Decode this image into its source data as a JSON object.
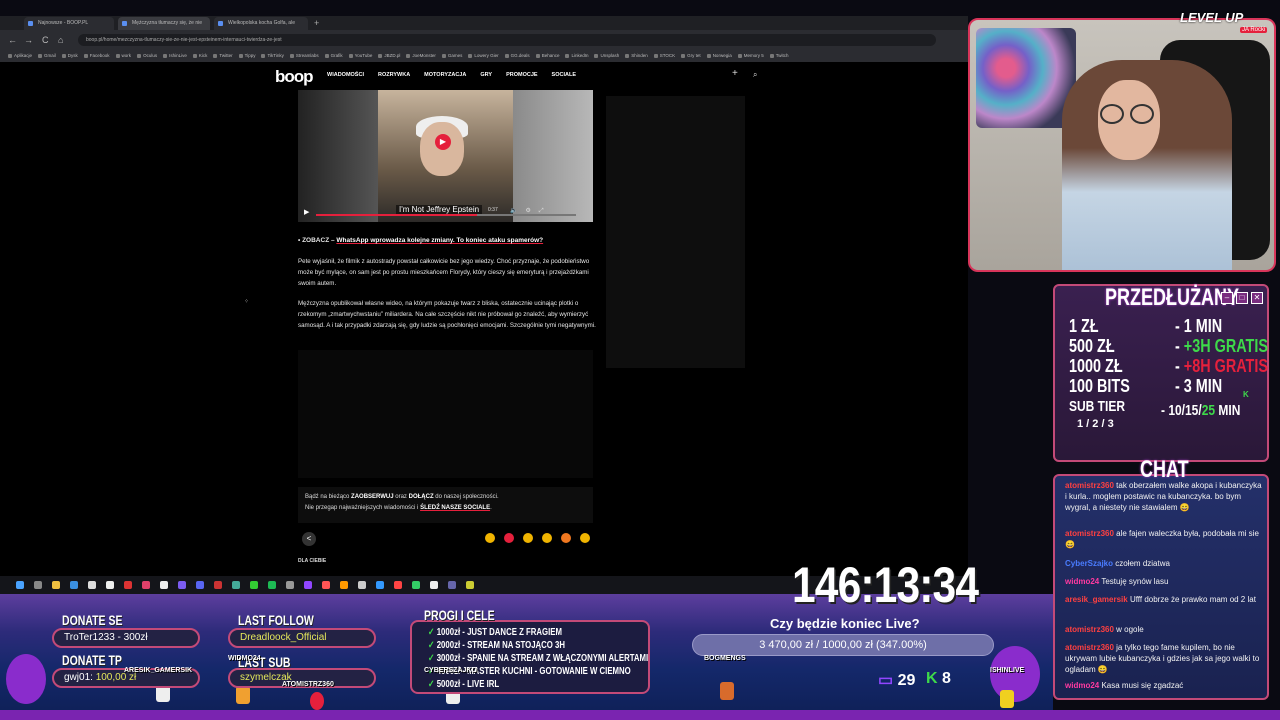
{
  "browser": {
    "tabs": [
      "Najnowsze - BOOP.PL",
      "Mężczyzna tłumaczy się, że nie",
      "Wielkopolska kocha Golfa, ale"
    ],
    "new_tab": "+",
    "url": "boop.pl/home/mezczyzna-tlumaczy-sie-ze-nie-jest-epsteinem-internauci-twierdza-ze-jest",
    "nav": {
      "back": "←",
      "forward": "→",
      "reload": "C",
      "home": "⌂"
    },
    "bookmarks": [
      "Aplikacje",
      "Gmail",
      "Dysk",
      "Facebook",
      "work",
      "Oculus",
      "IshinLive",
      "Kick",
      "Twitter",
      "Tippy",
      "TikTinky",
      "Streamlabs",
      "Grafik",
      "YouTube",
      "JBZD.pl",
      "JoeMonster",
      "Games",
      "Lowery Gier",
      "GG.deals",
      "Behance",
      "LinkedIn",
      "Unsplash",
      "Shinden",
      "STOCK",
      "Gry tet",
      "Norwegia",
      "Memory 5",
      "Twitch"
    ]
  },
  "site": {
    "logo": "boop",
    "nav": [
      "WIADOMOŚCI",
      "ROZRYWKA",
      "MOTORYZACJA",
      "GRY",
      "PROMOCJE",
      "SOCIALE"
    ],
    "plus": "+",
    "search": "⌕",
    "video": {
      "caption": "I'm Not Jeffrey Epstein",
      "time": "0:37",
      "progress": 0.62
    },
    "zobacz_prefix": "• ZOBACZ – ",
    "zobacz_link": "WhatsApp wprowadza kolejne zmiany. To koniec ataku spamerów?",
    "p1": "Pete wyjaśnił, że filmik z autostrady powstał całkowicie bez jego wiedzy. Choć przyznaje, że podobieństwo może być mylące, on sam jest po prostu mieszkańcem Florydy, który cieszy się emeryturą i przejażdżkami swoim autem.",
    "p2": "Mężczyzna opublikował własne wideo, na którym pokazuje twarz z bliska, ostatecznie ucinając plotki o rzekomym „zmartwychwstaniu” miliardera. Na całe szczęście nikt nie próbował go znaleźć, aby wymierzyć samosąd. A i tak przypadki zdarzają się, gdy ludzie są pochłonięci emocjami. Szczególnie tymi negatywnymi.",
    "follow_1a": "Bądź na bieżąco ",
    "follow_1b": "ZAOBSERWUJ",
    "follow_1c": " oraz ",
    "follow_1d": "DOŁĄCZ",
    "follow_1e": " do naszej społeczności.",
    "follow_2a": "Nie przegap najważniejszych wiadomości i ",
    "follow_2b": "ŚLEDŹ NASZE SOCIALE",
    "follow_2c": ".",
    "dla_ciebie": "DLA CIEBIE"
  },
  "overlay": {
    "levelup": "LEVEL UP",
    "levelup_sub": "JA Rocki",
    "prices_title": "PRZEDŁUŻANY",
    "prices": [
      {
        "amount": "1 ZŁ",
        "time": "- 1 MIN"
      },
      {
        "amount": "500 ZŁ",
        "time": "- ",
        "extra": "+3H GRATIS"
      },
      {
        "amount": "1000 ZŁ",
        "time": "- ",
        "extra": "+8H GRATIS"
      },
      {
        "amount": "100 BITS",
        "time": "- 3 MIN"
      },
      {
        "amount": "SUB TIER",
        "time": "- 10/15/",
        "extra": "25",
        "tail": " MIN"
      }
    ],
    "subtier_sub": "1 / 2 / 3",
    "k_mark": "K",
    "chat_title": "CHAT",
    "chat": [
      {
        "user": "atomistrz360",
        "text": " tak oberzałem walke akopa i kubanczyka i kurla.. moglem postawic na kubanczyka. bo bym wygral, a niestety nie stawialem 😄"
      },
      {
        "user": "atomistrz360",
        "text": " ale fajen waleczka była, podobała mi sie 😄"
      },
      {
        "user": "CyberSzajko",
        "text": " czołem dziatwa"
      },
      {
        "user": "widmo24",
        "text": " Testuję synów lasu"
      },
      {
        "user": "aresik_gamersik",
        "text": " Ufff dobrze że prawko mam od 2 lat"
      },
      {
        "user": "atomistrz360",
        "text": " w ogole"
      },
      {
        "user": "atomistrz360",
        "text": " ja tylko tego fame kupilem, bo nie ukrywam lubie kubanczyka i gdzies jak sa jego walki to ogladam 😄"
      },
      {
        "user": "widmo24",
        "text": " Kasa musi się zgadzać"
      }
    ],
    "donate_se_title": "DONATE SE",
    "donate_se": "TroTer1233 - 300zł",
    "donate_tp_title": "DONATE TP",
    "donate_tp_user": "gwj01: ",
    "donate_tp_amount": "100,00 zł",
    "last_follow_title": "LAST FOLLOW",
    "last_follow": "Dreadloock_Official",
    "last_sub_title": "LAST SUB",
    "last_sub": "szymelczak",
    "cele_title": "PROGI I CELE",
    "cele": [
      "1000zł - JUST DANCE Z FRAGIEM",
      "2000zł - STREAM NA STOJĄCO 3H",
      "3000zł - SPANIE NA STREAM Z WŁĄCZONYMI ALERTAMI",
      "4000zł - MASTER KUCHNI - GOTOWANIE W CIEMNO",
      "5000zł - LIVE IRL"
    ],
    "check": "✓",
    "timer": "146:13:34",
    "goal_title": "Czy będzie koniec Live?",
    "goal_text": "3 470,00 zł / 1000,00 zł (347.00%)",
    "goal_progress": 1.0,
    "twitch_icon": "▭",
    "twitch_count": "29",
    "kick_icon": "K",
    "kick_count": "8",
    "tags": [
      "ARESIK_GAMERSIK",
      "WIDMO24",
      "ATOMISTRZ360",
      "CYBERSZAJKO",
      "BOGMENGS",
      "ISHINLIVE"
    ]
  },
  "colors": {
    "accent": "#e5203c",
    "frame": "#c34a78",
    "green": "#3ed94a",
    "twitch": "#9146ff"
  }
}
